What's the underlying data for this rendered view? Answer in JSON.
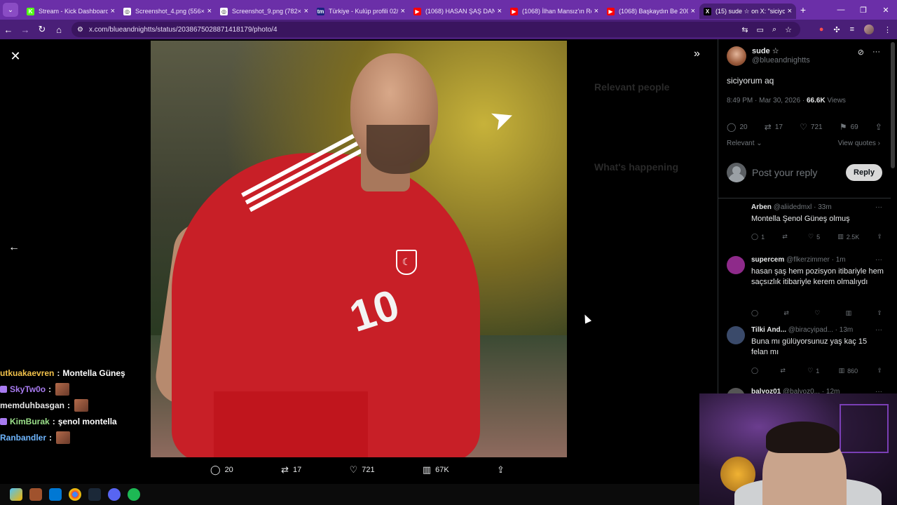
{
  "browser": {
    "tabs": [
      {
        "label": "Stream - Kick Dashboard",
        "favicon_color": "#53fc18",
        "glyph": "K"
      },
      {
        "label": "Screenshot_4.png (556×3",
        "favicon_color": "#ffffff",
        "glyph": "◎"
      },
      {
        "label": "Screenshot_9.png (782×4",
        "favicon_color": "#ffffff",
        "glyph": "◎"
      },
      {
        "label": "Türkiye - Kulüp profili 02/",
        "favicon_color": "#1a237e",
        "glyph": "tm"
      },
      {
        "label": "(1068) HASAN ŞAŞ DAND",
        "favicon_color": "#ff0000",
        "glyph": "▶"
      },
      {
        "label": "(1068) İlhan Mansız'ın Ro",
        "favicon_color": "#ff0000",
        "glyph": "▶"
      },
      {
        "label": "(1068) Başkaydın Be 2002",
        "favicon_color": "#ff0000",
        "glyph": "▶"
      },
      {
        "label": "(15) sude ☆ on X: \"siciyo",
        "favicon_color": "#000000",
        "glyph": "X"
      }
    ],
    "url": "x.com/blueandnightts/status/2038675028871418179/photo/4"
  },
  "photo_actions": {
    "replies": "20",
    "reposts": "17",
    "likes": "721",
    "views": "67K"
  },
  "tweet": {
    "author_name": "sude ☆",
    "author_handle": "@blueandnightts",
    "text": "siciyorum aq",
    "time": "8:49 PM · Mar 30, 2026 · ",
    "views_count": "66.6K",
    "views_label": " Views",
    "replies": "20",
    "reposts": "17",
    "likes": "721",
    "bookmarks": "69",
    "sort_label": "Relevant",
    "view_quotes": "View quotes",
    "reply_placeholder": "Post your reply",
    "reply_button": "Reply"
  },
  "replies": [
    {
      "name": "Arben",
      "handle": "@aliidedmxl",
      "time": "33m",
      "text": "Montella Şenol Güneş olmuş",
      "replies": "1",
      "reposts": "",
      "likes": "5",
      "views": "2.5K",
      "avatar_color": "#000000"
    },
    {
      "name": "supercem",
      "handle": "@flkerzimmer",
      "time": "1m",
      "text": "hasan şaş hem pozisyon itibariyle hem saçsızlık itibariyle kerem olmalıydı",
      "replies": "",
      "reposts": "",
      "likes": "",
      "views": "",
      "avatar_color": "#8e2a8a"
    },
    {
      "name": "Tilki And...",
      "handle": "@biracyipad...",
      "time": "13m",
      "text": "Buna mı gülüyorsunuz yaş kaç 15 felan mı",
      "replies": "",
      "reposts": "",
      "likes": "1",
      "views": "860",
      "avatar_color": "#3a4a6a"
    },
    {
      "name": "balyoz01",
      "handle": "@balyoz0...",
      "time": "12m",
      "text": "",
      "replies": "",
      "reposts": "",
      "likes": "",
      "views": "",
      "avatar_color": "#555555"
    }
  ],
  "background_right": {
    "relevant_people": "Relevant people",
    "whats_happening": "What's happening"
  },
  "chat": [
    {
      "user": "utkuakaevren",
      "msg": "Montella Güneş",
      "emote": false
    },
    {
      "user": "SkyTw0o",
      "msg": "",
      "emote": true
    },
    {
      "user": "memduhbasgan",
      "msg": "",
      "emote": true
    },
    {
      "user": "KimBurak",
      "msg": "şenol montella",
      "emote": false
    },
    {
      "user": "Ranbandler",
      "msg": "",
      "emote": true
    }
  ],
  "chat_colon": ":",
  "colors": {
    "tab_strip": "#6b2fa8",
    "toolbar": "#4a1f78",
    "jersey": "#c81f27",
    "x_background": "#000000"
  },
  "photo_jersey_number": "10"
}
